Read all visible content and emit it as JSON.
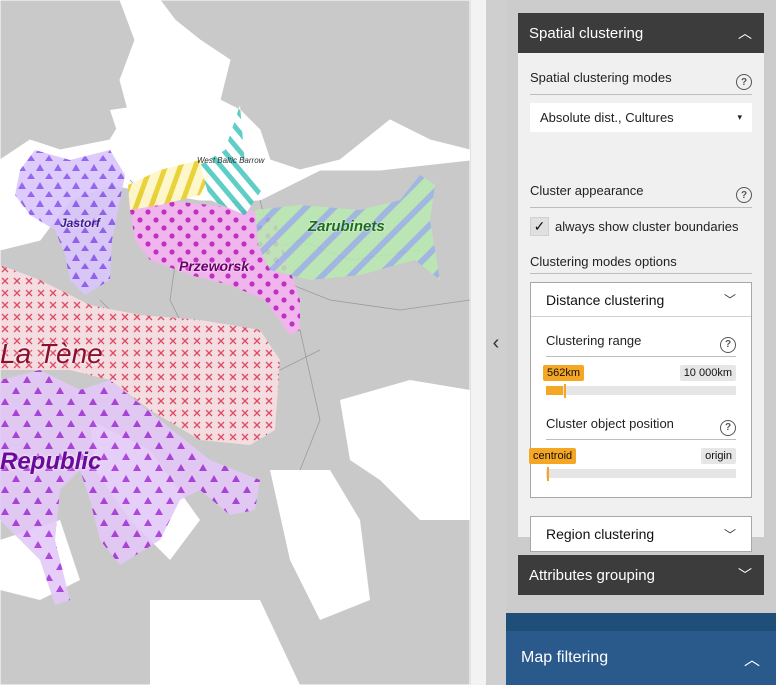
{
  "map": {
    "labels": {
      "jastorf": "Jastorf",
      "west_baltic": "West Baltic Barrow",
      "przeworsk": "Przeworsk",
      "zarubinets": "Zarubinets",
      "la_tene": "La Tène",
      "republic": "Republic"
    },
    "colors": {
      "land": "#c9c9c9",
      "sea": "#ffffff",
      "jastorf": "#9a6cf0",
      "przeworsk": "#e040e0",
      "zarubinets": "#7be07b",
      "la_tene": "#e8304f",
      "republic": "#b34be6",
      "baltic": "#e8d020"
    }
  },
  "splitter": {
    "icon": "chevron-left-icon",
    "glyph": "‹"
  },
  "panel": {
    "spatial_clustering": {
      "title": "Spatial clustering",
      "modes_label": "Spatial clustering modes",
      "mode_value": "Absolute dist., Cultures",
      "appearance_label": "Cluster appearance",
      "always_show_label": "always show cluster boundaries",
      "always_show_checked": true,
      "options_label": "Clustering modes options",
      "distance": {
        "title": "Distance clustering",
        "range_label": "Clustering range",
        "range_min_tag": "562km",
        "range_max_tag": "10 000km",
        "range_value_fraction": 0.09,
        "position_label": "Cluster object position",
        "position_min_tag": "centroid",
        "position_max_tag": "origin",
        "position_value_fraction": 0.0
      },
      "region": {
        "title": "Region clustering"
      }
    },
    "attributes_grouping": {
      "title": "Attributes grouping"
    },
    "map_filtering": {
      "title": "Map filtering"
    },
    "help_glyph": "?",
    "check_glyph": "✓",
    "chev_up": "︿",
    "chev_down": "﹀",
    "caret": "▾",
    "colors": {
      "header_dark": "#3c3c3c",
      "accent_orange": "#f5a623",
      "map_filter_blue": "#2a5a8c"
    }
  }
}
